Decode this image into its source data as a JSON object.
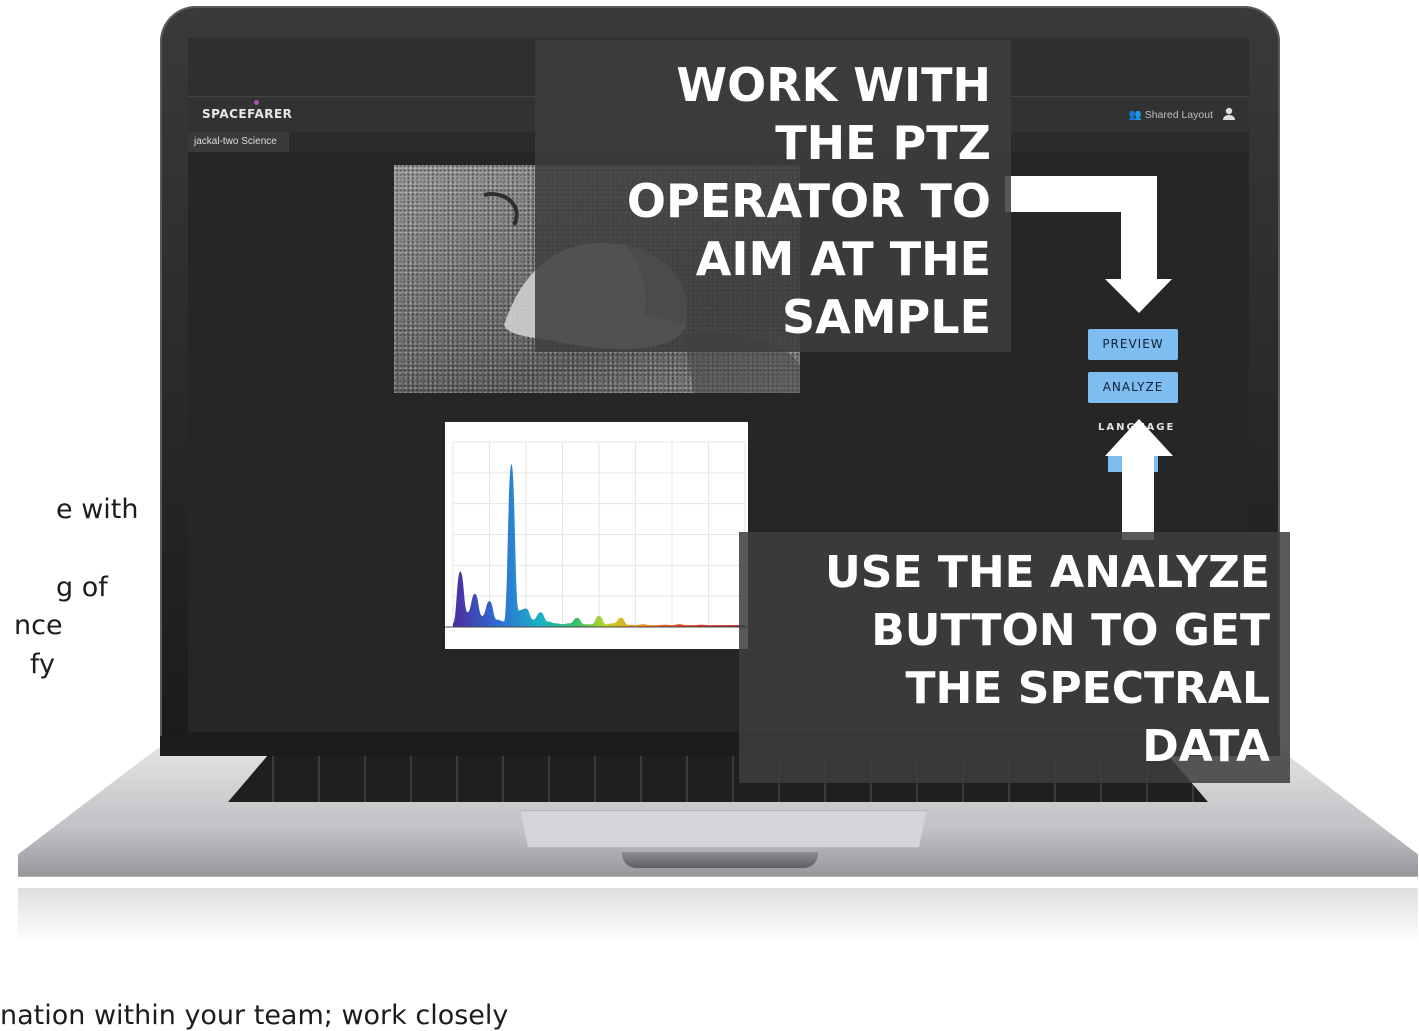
{
  "left_text": {
    "line1": "e with",
    "line2": "g of",
    "line3": "nce",
    "line4": "fy"
  },
  "bottom_text": "nation within your team; work closely",
  "app": {
    "logo": "SPACEFARER",
    "shared_layout": "Shared Layout",
    "tab": "jackal-two Science",
    "preview_button": "PREVIEW",
    "analyze_button": "ANALYZE",
    "language_label": "LANGUAGE"
  },
  "callout_top": {
    "lines": [
      "WORK WITH",
      "THE PTZ",
      "OPERATOR TO",
      "AIM AT THE",
      "SAMPLE"
    ]
  },
  "callout_bottom": {
    "lines": [
      "USE THE ANALYZE",
      "BUTTON TO GET",
      "THE SPECTRAL",
      "DATA"
    ]
  },
  "chart_data": {
    "type": "area",
    "title": "",
    "xlabel": "",
    "ylabel": "",
    "series": [
      {
        "x": [
          0,
          1,
          2,
          3,
          4,
          5,
          6,
          7,
          8,
          9,
          10,
          11,
          12,
          13,
          14,
          15,
          16,
          17,
          18,
          19,
          20,
          21,
          22,
          23,
          24,
          25,
          26,
          27,
          28,
          29,
          30,
          31,
          32,
          33,
          34,
          35,
          36,
          37,
          38,
          39,
          40
        ],
        "values": [
          2,
          30,
          8,
          18,
          6,
          14,
          4,
          3,
          88,
          9,
          10,
          4,
          8,
          3,
          2,
          1.5,
          2,
          5,
          1.5,
          1.5,
          6,
          1.5,
          2,
          5,
          1.2,
          1,
          1.5,
          1,
          1,
          1.2,
          1,
          1.5,
          1,
          1,
          1.2,
          1,
          1,
          1,
          1,
          1,
          1
        ]
      }
    ],
    "color_gradient": [
      "#4b2c9e",
      "#2f6fd6",
      "#1ab3c4",
      "#34c06a",
      "#b7d52a",
      "#f0a020",
      "#e2452d",
      "#b21e2e"
    ],
    "grid": true
  }
}
